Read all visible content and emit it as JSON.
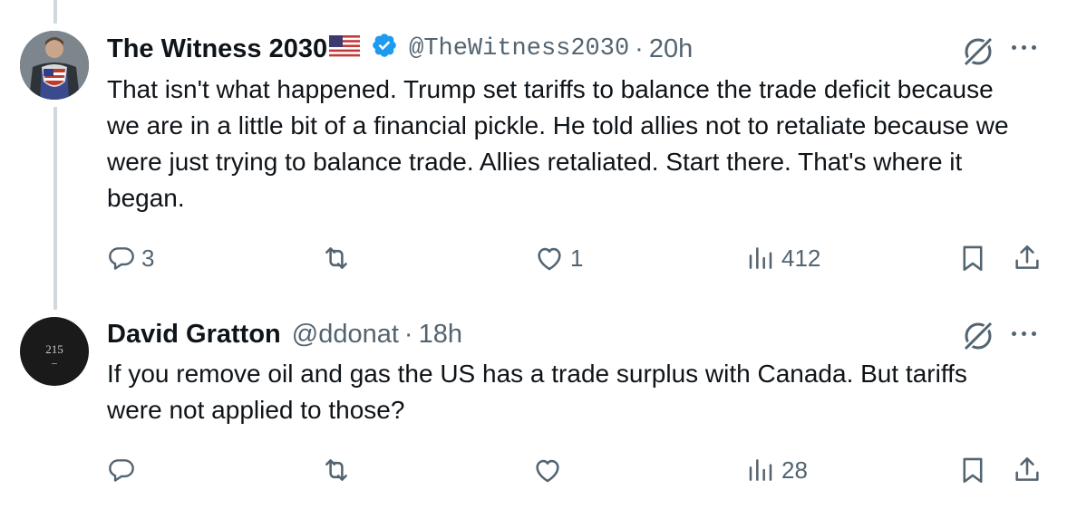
{
  "tweets": [
    {
      "display_name": "The Witness 2030",
      "handle": "@TheWitness2030",
      "separator": "·",
      "time": "20h",
      "text": "That isn't what happened. Trump set tariffs to balance the trade deficit because we are in a little bit of a financial pickle. He told allies not to retaliate because we were just trying to balance trade. Allies retaliated. Start there. That's where it began.",
      "actions": {
        "replies": "3",
        "reposts": "",
        "likes": "1",
        "views": "412"
      }
    },
    {
      "display_name": "David Gratton",
      "handle": "@ddonat",
      "separator": "·",
      "time": "18h",
      "avatar_text": "215",
      "text": "If you remove oil and gas the US has a trade surplus with Canada. But tariffs were not applied to those?",
      "actions": {
        "replies": "",
        "reposts": "",
        "likes": "",
        "views": "28"
      }
    }
  ],
  "colors": {
    "text": "#0f1419",
    "secondary": "#536471",
    "verified": "#1d9bf0",
    "thread_line": "#cfd9de"
  },
  "icons": [
    "us-flag-icon",
    "verified-badge-icon",
    "grok-icon",
    "more-icon",
    "reply-icon",
    "repost-icon",
    "like-icon",
    "views-icon",
    "bookmark-icon",
    "share-icon"
  ]
}
